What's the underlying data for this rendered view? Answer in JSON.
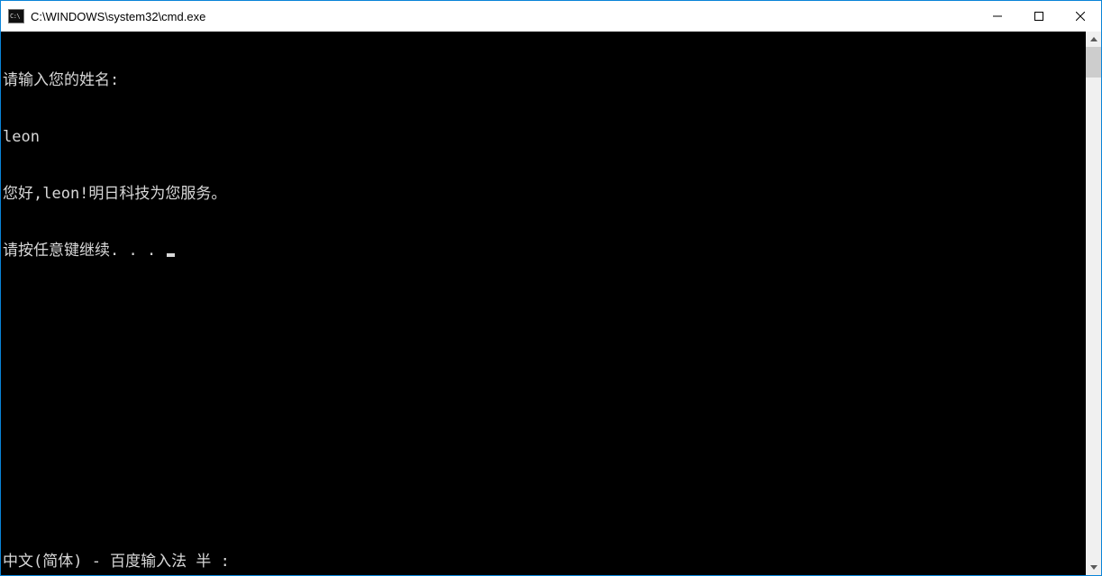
{
  "window": {
    "title": "C:\\WINDOWS\\system32\\cmd.exe"
  },
  "console": {
    "lines": [
      "请输入您的姓名:",
      "leon",
      "您好,leon!明日科技为您服务。",
      "请按任意键继续. . . "
    ]
  },
  "ime": {
    "status": "中文(简体) - 百度输入法 半 :"
  }
}
